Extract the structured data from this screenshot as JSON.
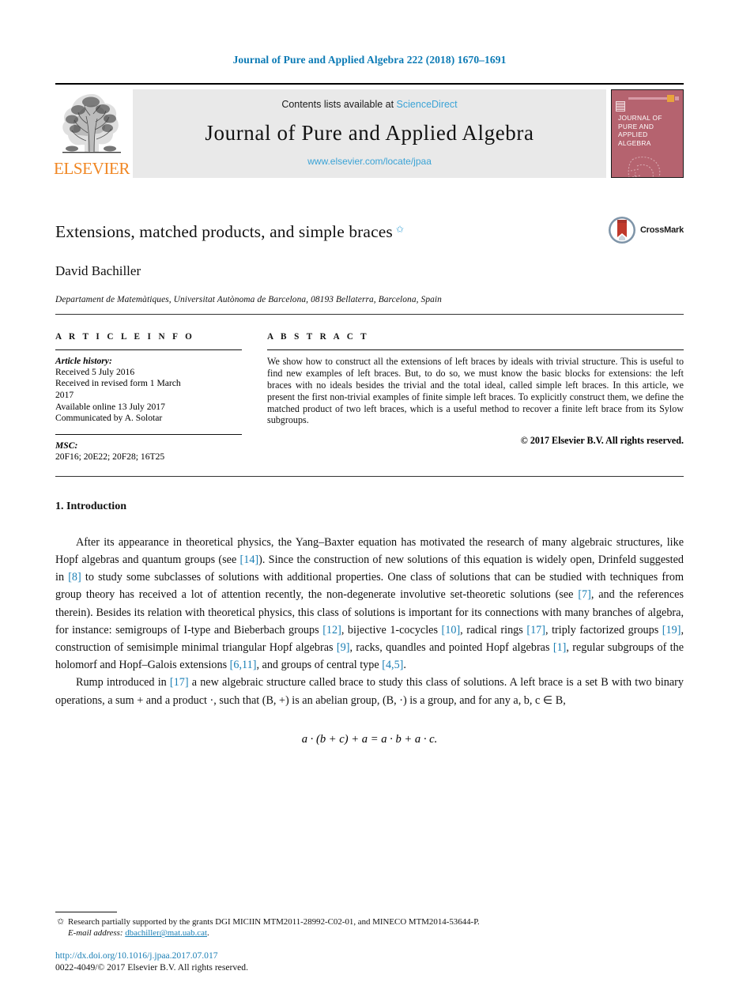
{
  "running_head": "Journal of Pure and Applied Algebra 222 (2018) 1670–1691",
  "masthead": {
    "publisher_wordmark": "ELSEVIER",
    "contents_prefix": "Contents lists available at ",
    "contents_link": "ScienceDirect",
    "journal_name": "Journal of Pure and Applied Algebra",
    "journal_url": "www.elsevier.com/locate/jpaa",
    "cover_title": "JOURNAL OF PURE AND APPLIED ALGEBRA",
    "cover_bg_color": "#b5636f",
    "link_color": "#3ba3d6"
  },
  "title_block": {
    "title": "Extensions, matched products, and simple braces",
    "title_footnote_marker": "✩",
    "author": "David Bachiller",
    "affiliation": "Departament de Matemàtiques, Universitat Autònoma de Barcelona, 08193 Bellaterra, Barcelona, Spain",
    "crossmark_label": "CrossMark"
  },
  "article_info": {
    "section_label": "A R T I C L E   I N F O",
    "history_title": "Article history:",
    "history": [
      "Received 5 July 2016",
      "Received in revised form 1 March",
      "2017",
      "Available online 13 July 2017",
      "Communicated by A. Solotar"
    ],
    "msc_title": "MSC:",
    "msc_codes": "20F16; 20E22; 20F28; 16T25"
  },
  "abstract": {
    "section_label": "A B S T R A C T",
    "text": "We show how to construct all the extensions of left braces by ideals with trivial structure. This is useful to find new examples of left braces. But, to do so, we must know the basic blocks for extensions: the left braces with no ideals besides the trivial and the total ideal, called simple left braces. In this article, we present the first non-trivial examples of finite simple left braces. To explicitly construct them, we define the matched product of two left braces, which is a useful method to recover a finite left brace from its Sylow subgroups.",
    "copyright": "© 2017 Elsevier B.V. All rights reserved."
  },
  "introduction": {
    "heading": "1. Introduction",
    "paragraph1_parts": [
      "After its appearance in theoretical physics, the Yang–Baxter equation has motivated the research of many algebraic structures, like Hopf algebras and quantum groups (see ",
      "[14]",
      "). Since the construction of new solutions of this equation is widely open, Drinfeld suggested in ",
      "[8]",
      " to study some subclasses of solutions with additional properties. One class of solutions that can be studied with techniques from group theory has received a lot of attention recently, the non-degenerate involutive set-theoretic solutions (see ",
      "[7]",
      ", and the references therein). Besides its relation with theoretical physics, this class of solutions is important for its connections with many branches of algebra, for instance: semigroups of I-type and Bieberbach groups ",
      "[12]",
      ", bijective 1-cocycles ",
      "[10]",
      ", radical rings ",
      "[17]",
      ", triply factorized groups ",
      "[19]",
      ", construction of semisimple minimal triangular Hopf algebras ",
      "[9]",
      ", racks, quandles and pointed Hopf algebras ",
      "[1]",
      ", regular subgroups of the holomorf and Hopf–Galois extensions ",
      "[6,11]",
      ", and groups of central type ",
      "[4,5]",
      "."
    ],
    "paragraph2_parts": [
      "Rump introduced in ",
      "[17]",
      " a new algebraic structure called brace to study this class of solutions. A left brace is a set B with two binary operations, a sum + and a product ·, such that (B, +) is an abelian group, (B, ·) is a group, and for any a, b, c ∈ B,"
    ],
    "equation": "a · (b + c) + a = a · b + a · c.",
    "citation_color": "#1a7fb5"
  },
  "footnotes": {
    "star_marker": "✩",
    "grant_text": "Research partially supported by the grants DGI MICIIN MTM2011-28992-C02-01, and MINECO MTM2014-53644-P.",
    "email_label": "E-mail address:",
    "email": "dbachiller@mat.uab.cat",
    "email_suffix": "."
  },
  "footer": {
    "doi": "http://dx.doi.org/10.1016/j.jpaa.2017.07.017",
    "issn_line": "0022-4049/© 2017 Elsevier B.V. All rights reserved."
  }
}
